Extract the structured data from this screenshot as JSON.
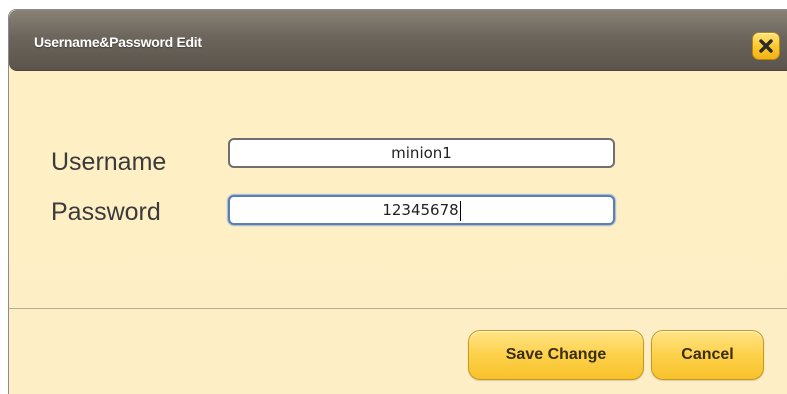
{
  "dialog": {
    "title": "Username&Password Edit",
    "close_icon": "close-icon"
  },
  "form": {
    "username_label": "Username",
    "username_value": "minion1",
    "password_label": "Password",
    "password_value": "12345678"
  },
  "actions": {
    "save_label": "Save Change",
    "cancel_label": "Cancel"
  },
  "colors": {
    "titlebar": "#6c655c",
    "dialog_background": "#fdeec6",
    "button_accent": "#fcc72d",
    "focus_border": "#5b7fb0"
  }
}
